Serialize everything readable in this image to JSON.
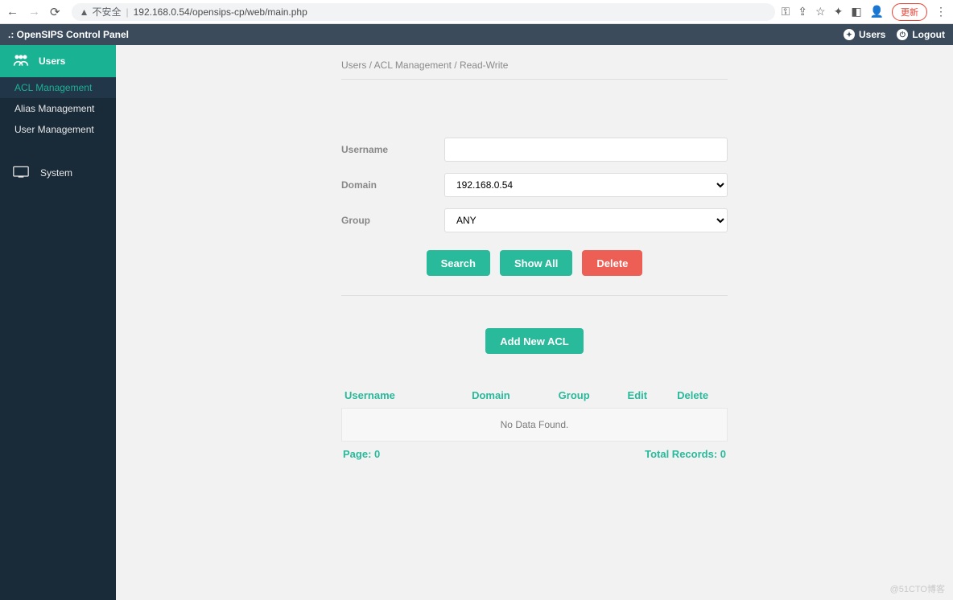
{
  "browser": {
    "insecure_label": "不安全",
    "url": "192.168.0.54/opensips-cp/web/main.php",
    "update_label": "更新"
  },
  "header": {
    "brand": ".: OpenSIPS Control Panel",
    "users_label": "Users",
    "logout_label": "Logout"
  },
  "sidebar": {
    "users_head": "Users",
    "items": [
      "ACL Management",
      "Alias Management",
      "User Management"
    ],
    "system_head": "System"
  },
  "breadcrumb": "Users / ACL Management / Read-Write",
  "form": {
    "username_label": "Username",
    "username_value": "",
    "domain_label": "Domain",
    "domain_value": "192.168.0.54",
    "group_label": "Group",
    "group_value": "ANY"
  },
  "buttons": {
    "search": "Search",
    "show_all": "Show All",
    "delete": "Delete",
    "add_new": "Add New ACL"
  },
  "table": {
    "headers": {
      "username": "Username",
      "domain": "Domain",
      "group": "Group",
      "edit": "Edit",
      "delete": "Delete"
    },
    "empty": "No Data Found.",
    "page_label": "Page: 0",
    "total_label": "Total Records: 0"
  },
  "watermark": "@51CTO博客"
}
